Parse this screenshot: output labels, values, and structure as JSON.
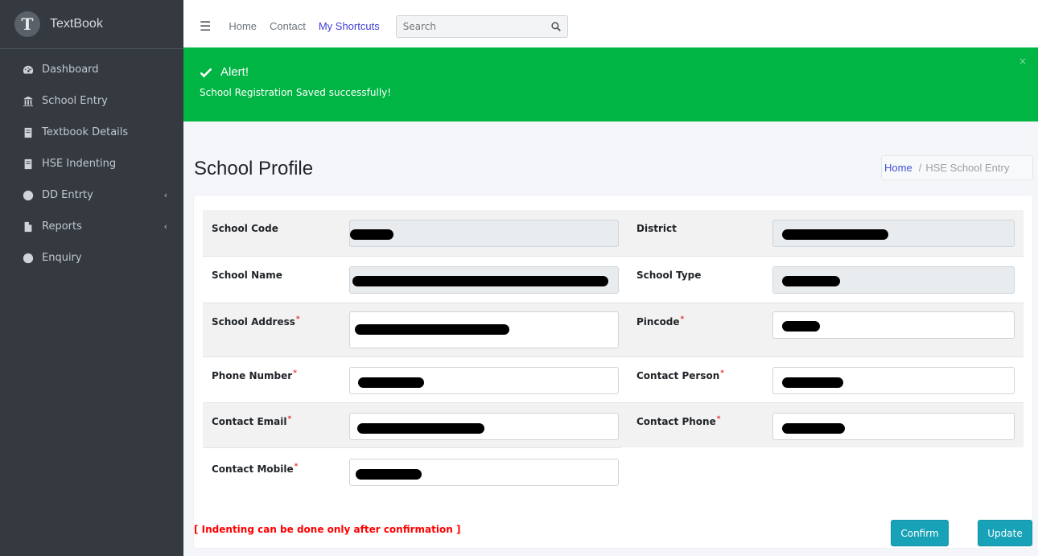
{
  "brand": {
    "name": "TextBook"
  },
  "sidebar": {
    "items": [
      {
        "label": "Dashboard",
        "icon": "dashboard-icon"
      },
      {
        "label": "School Entry",
        "icon": "school-icon"
      },
      {
        "label": "Textbook Details",
        "icon": "book-icon"
      },
      {
        "label": "HSE Indenting",
        "icon": "book-icon"
      },
      {
        "label": "DD Entrty",
        "icon": "circle-icon",
        "caret": "‹"
      },
      {
        "label": "Reports",
        "icon": "file-icon",
        "caret": "‹"
      },
      {
        "label": "Enquiry",
        "icon": "circle-icon"
      }
    ]
  },
  "topbar": {
    "links": [
      "Home",
      "Contact",
      "My Shortcuts"
    ],
    "search_placeholder": "Search"
  },
  "alert": {
    "title": "Alert!",
    "message": "School Registration Saved successfully!",
    "close": "×",
    "color": "#00b543"
  },
  "page": {
    "title": "School Profile",
    "breadcrumb": {
      "home": "Home",
      "separator": "/",
      "current": "HSE School Entry"
    }
  },
  "form": {
    "school_code": "School Code",
    "district": "District",
    "school_name": "School Name",
    "school_type": "School Type",
    "school_address": "School Address",
    "pincode": "Pincode",
    "phone_number": "Phone Number",
    "contact_person": "Contact Person",
    "contact_email": "Contact Email",
    "contact_phone": "Contact Phone",
    "contact_mobile": "Contact Mobile",
    "required_mark": "*"
  },
  "note": "[ Indenting can be done only after confirmation ]",
  "buttons": {
    "confirm": "Confirm",
    "update": "Update"
  },
  "colors": {
    "accent_button": "#17a2b8",
    "sidebar": "#343a40",
    "required": "#e3342f"
  }
}
